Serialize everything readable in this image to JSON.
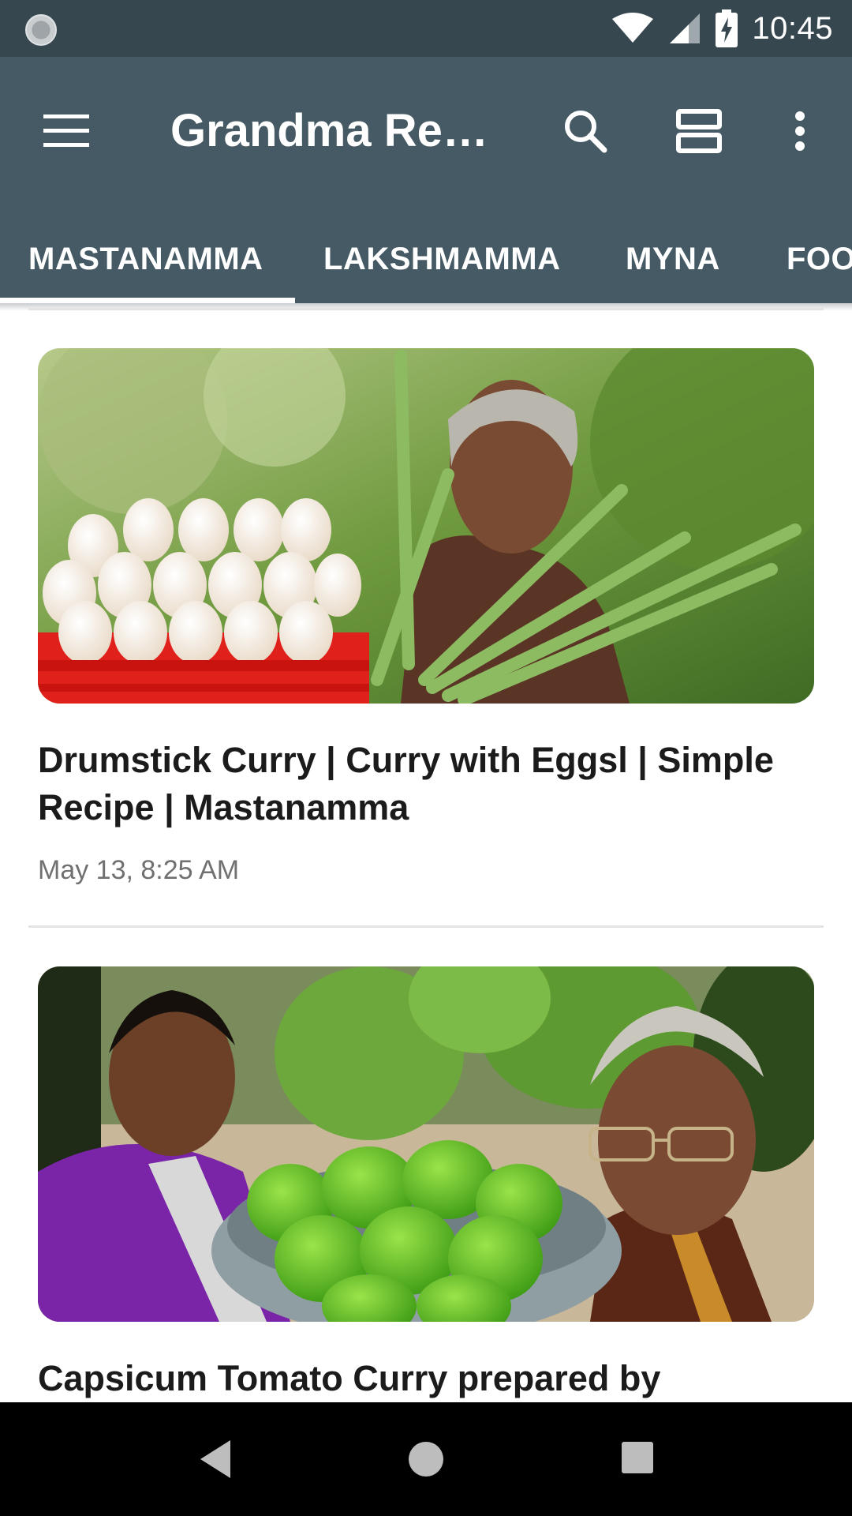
{
  "status_bar": {
    "time": "10:45"
  },
  "app_bar": {
    "title": "Grandma Reci…",
    "icons": {
      "menu": "menu-icon",
      "search": "search-icon",
      "layout": "view-agenda-icon",
      "more": "more-vert-icon"
    },
    "colors": {
      "toolbar": "#455a64",
      "status_bar": "#37474f"
    }
  },
  "tabs": [
    {
      "label": "MASTANAMMA",
      "selected": true
    },
    {
      "label": "LAKSHMAMMA",
      "selected": false
    },
    {
      "label": "MYNA",
      "selected": false
    },
    {
      "label": "FOO",
      "selected": false
    }
  ],
  "videos": [
    {
      "title": "Drumstick Curry | Curry with Eggsl | Simple Recipe | Mastanamma",
      "date": "May 13, 8:25 AM"
    },
    {
      "title": "Capsicum Tomato Curry prepared by",
      "date": ""
    }
  ]
}
